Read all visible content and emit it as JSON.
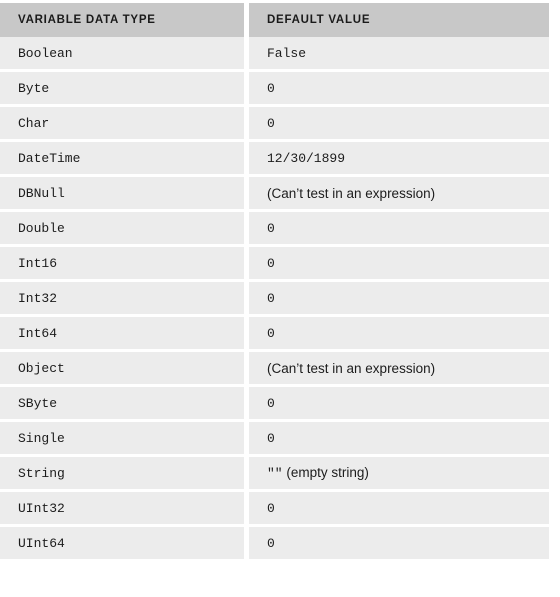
{
  "table": {
    "columns": [
      {
        "key": "type",
        "label": "VARIABLE DATA TYPE"
      },
      {
        "key": "value",
        "label": "DEFAULT VALUE"
      }
    ],
    "header_background": "#c8c8c8",
    "row_background": "#ececec",
    "page_background": "#ffffff",
    "text_color": "#1c1c1c",
    "rows": [
      {
        "type": "Boolean",
        "value": "False",
        "value_style": "code"
      },
      {
        "type": "Byte",
        "value": "0",
        "value_style": "code"
      },
      {
        "type": "Char",
        "value": "0",
        "value_style": "code"
      },
      {
        "type": "DateTime",
        "value": "12/30/1899",
        "value_style": "code"
      },
      {
        "type": "DBNull",
        "value": "(Can’t test in an expression)",
        "value_style": "prose"
      },
      {
        "type": "Double",
        "value": "0",
        "value_style": "code"
      },
      {
        "type": "Int16",
        "value": "0",
        "value_style": "code"
      },
      {
        "type": "Int32",
        "value": "0",
        "value_style": "code"
      },
      {
        "type": "Int64",
        "value": "0",
        "value_style": "code"
      },
      {
        "type": "Object",
        "value": "(Can’t test in an expression)",
        "value_style": "prose"
      },
      {
        "type": "SByte",
        "value": "0",
        "value_style": "code"
      },
      {
        "type": "Single",
        "value": "0",
        "value_style": "code"
      },
      {
        "type": "String",
        "value": "\"\" (empty string)",
        "value_style": "mixed",
        "value_code_part": "\"\"",
        "value_prose_part": " (empty string)"
      },
      {
        "type": "UInt32",
        "value": "0",
        "value_style": "code"
      },
      {
        "type": "UInt64",
        "value": "0",
        "value_style": "code"
      }
    ]
  }
}
